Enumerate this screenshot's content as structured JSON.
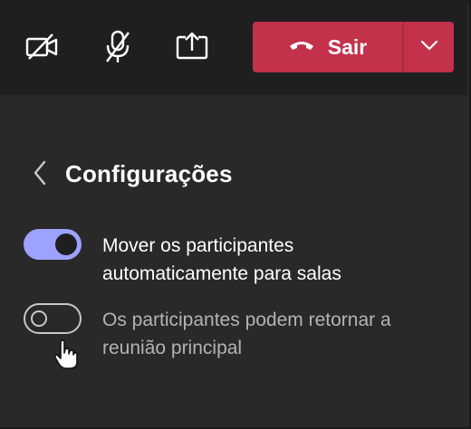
{
  "toolbar": {
    "camera_icon": "camera-off-icon",
    "mic_icon": "mic-off-icon",
    "share_icon": "share-screen-icon",
    "leave_label": "Sair",
    "leave_color": "#c4314b"
  },
  "settings": {
    "title": "Configurações",
    "options": [
      {
        "label_line1": "Mover os participantes",
        "label_line2": "automaticamente para salas",
        "checked": true
      },
      {
        "label_line1": "Os participantes podem retornar a",
        "label_line2": "reunião principal",
        "checked": false
      }
    ],
    "accent_color": "#9ea2ff"
  }
}
